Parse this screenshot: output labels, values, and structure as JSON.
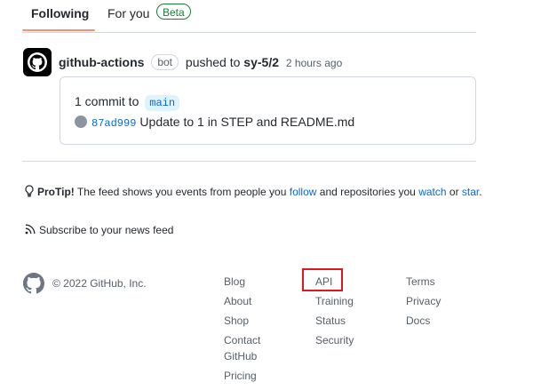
{
  "tabs": {
    "following": "Following",
    "for_you": "For you",
    "beta": "Beta"
  },
  "feed_item": {
    "actor": "github-actions",
    "bot_badge": "bot",
    "action": "pushed to",
    "repo": "sy-5/2",
    "time": "2 hours ago",
    "commit_count_prefix": "1 commit to",
    "branch": "main",
    "commit": {
      "sha": "87ad999",
      "message": "Update to 1 in STEP and README.md"
    }
  },
  "protip": {
    "label": "ProTip!",
    "text_1": "The feed shows you events from people you",
    "link_follow": "follow",
    "text_2": "and repositories you",
    "link_watch": "watch",
    "text_3": "or",
    "link_star": "star",
    "text_4": "."
  },
  "subscribe": "Subscribe to your news feed",
  "footer": {
    "copyright": "© 2022 GitHub, Inc.",
    "col1": [
      "Blog",
      "About",
      "Shop",
      "Contact GitHub",
      "Pricing"
    ],
    "col2": [
      "API",
      "Training",
      "Status",
      "Security"
    ],
    "col3": [
      "Terms",
      "Privacy",
      "Docs"
    ]
  },
  "colors": {
    "accent_link": "#0969da",
    "beta_green": "#1a7f37",
    "tab_underline": "#fd8c73",
    "highlight_red": "#e0161f"
  }
}
